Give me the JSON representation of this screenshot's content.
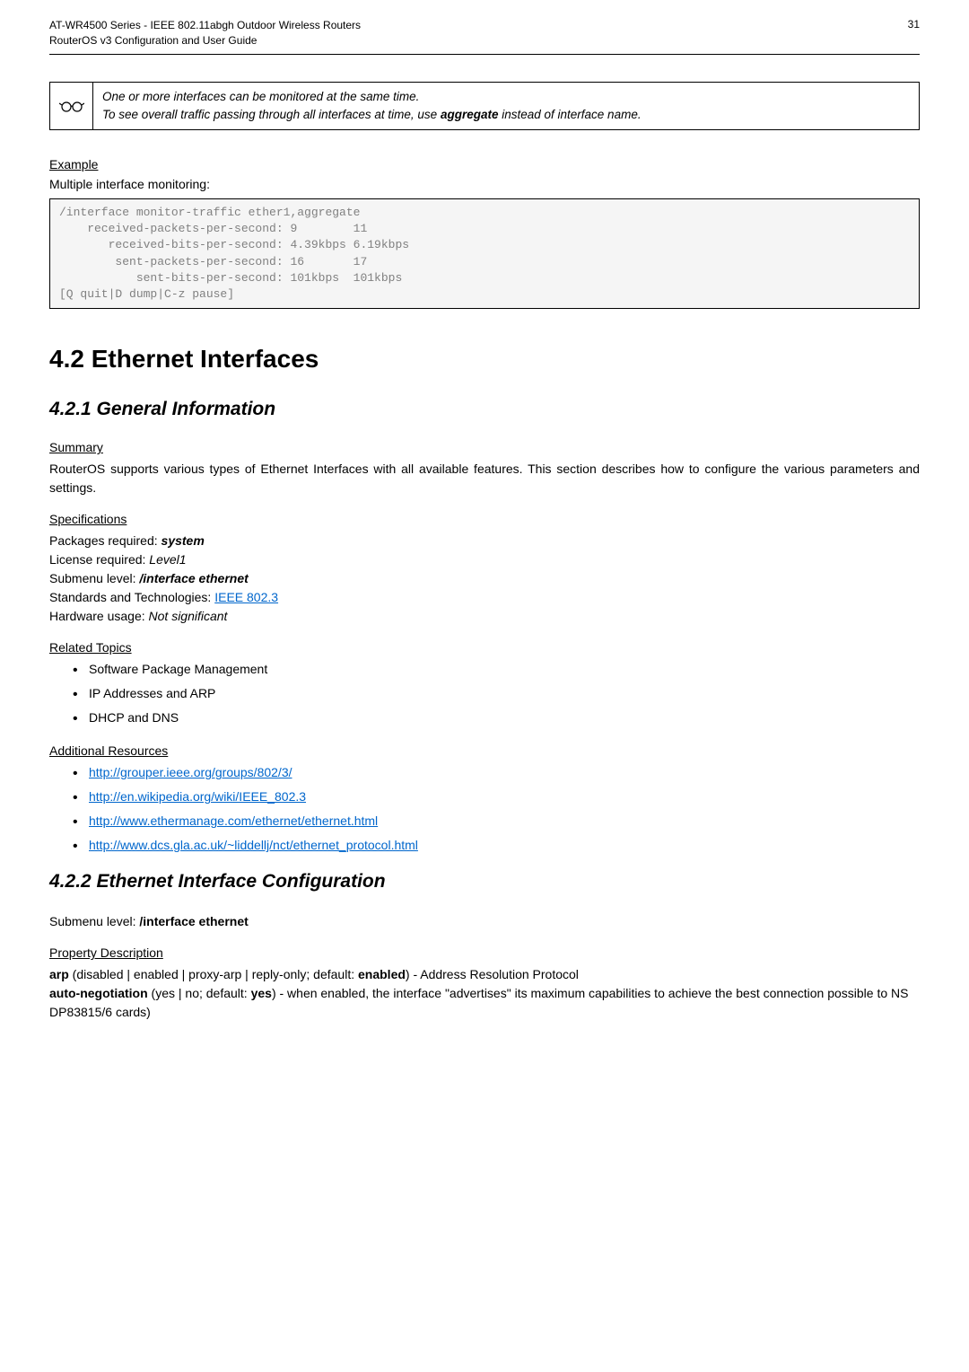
{
  "header": {
    "line1": "AT-WR4500 Series - IEEE 802.11abgh Outdoor Wireless Routers",
    "line2": "RouterOS v3 Configuration and User Guide",
    "page_number": "31"
  },
  "note_box": {
    "line1": "One or more interfaces can be monitored at the same time.",
    "line2_a": "To see overall traffic passing through all interfaces at time, use ",
    "line2_bold": "aggregate",
    "line2_b": " instead of interface name."
  },
  "example": {
    "heading": "Example",
    "intro": "Multiple interface monitoring:",
    "code": "/interface monitor-traffic ether1,aggregate\n    received-packets-per-second: 9        11\n       received-bits-per-second: 4.39kbps 6.19kbps\n        sent-packets-per-second: 16       17\n           sent-bits-per-second: 101kbps  101kbps\n[Q quit|D dump|C-z pause]"
  },
  "section_4_2": {
    "title": "4.2  Ethernet Interfaces"
  },
  "section_4_2_1": {
    "title": "4.2.1  General Information",
    "summary_heading": "Summary",
    "summary_text": "RouterOS supports various types of Ethernet Interfaces with all available features. This section describes how to configure the various parameters and settings.",
    "specs_heading": "Specifications",
    "specs": {
      "packages_label": "Packages required: ",
      "packages_value": "system",
      "license_label": "License required: ",
      "license_value": "Level1",
      "submenu_label": "Submenu level: ",
      "submenu_value": "/interface ethernet",
      "standards_label": "Standards and Technologies: ",
      "standards_link": "IEEE 802.3",
      "hardware_label": "Hardware usage: ",
      "hardware_value": "Not significant"
    },
    "related_heading": "Related Topics",
    "related_items": {
      "0": "Software Package Management",
      "1": "IP Addresses and ARP",
      "2": "DHCP and DNS"
    },
    "resources_heading": "Additional Resources",
    "resources_items": {
      "0": "http://grouper.ieee.org/groups/802/3/",
      "1": "http://en.wikipedia.org/wiki/IEEE_802.3",
      "2": "http://www.ethermanage.com/ethernet/ethernet.html",
      "3": "http://www.dcs.gla.ac.uk/~liddellj/nct/ethernet_protocol.html"
    }
  },
  "section_4_2_2": {
    "title": "4.2.2  Ethernet Interface Configuration",
    "submenu_label": "Submenu level: ",
    "submenu_value": "/interface ethernet",
    "prop_heading": "Property Description",
    "prop1_a": "arp",
    "prop1_b": " (disabled | enabled | proxy-arp | reply-only; default: ",
    "prop1_c": "enabled",
    "prop1_d": ") - Address Resolution Protocol",
    "prop2_a": "auto-negotiation",
    "prop2_b": " (yes | no; default: ",
    "prop2_c": "yes",
    "prop2_d": ") - when enabled, the interface \"advertises\" its maximum capabilities to achieve the best connection possible  to NS DP83815/6 cards)"
  }
}
